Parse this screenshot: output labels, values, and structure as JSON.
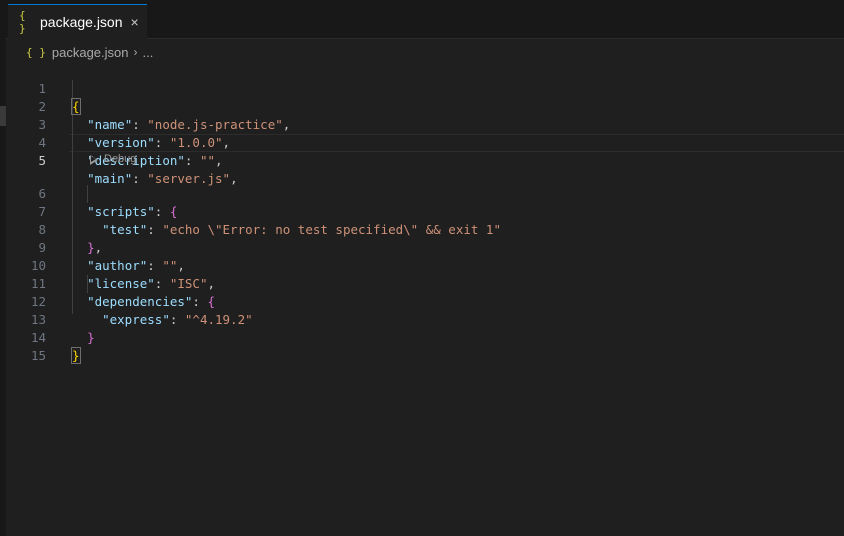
{
  "tab": {
    "icon": "{ }",
    "label": "package.json",
    "close": "×",
    "icon_name": "json-icon"
  },
  "breadcrumb": {
    "icon": "{ }",
    "file": "package.json",
    "separator": "›",
    "more": "..."
  },
  "codelens": {
    "label": "Debug",
    "icon_name": "play-icon"
  },
  "colors": {
    "key": "#9cdcfe",
    "string": "#ce9178",
    "bracket1": "#ffd700",
    "bracket2": "#da70d6",
    "accent": "#0078d4"
  },
  "editor": {
    "active_line": 5,
    "lines": [
      {
        "n": "1"
      },
      {
        "n": "2",
        "key": "\"name\"",
        "val": "\"node.js-practice\""
      },
      {
        "n": "3",
        "key": "\"version\"",
        "val": "\"1.0.0\""
      },
      {
        "n": "4",
        "key": "\"description\"",
        "val": "\"\""
      },
      {
        "n": "5",
        "key": "\"main\"",
        "val": "\"server.js\""
      },
      {
        "n": "6",
        "key": "\"scripts\""
      },
      {
        "n": "7",
        "key": "\"test\"",
        "val": "\"echo \\\"Error: no test specified\\\" && exit 1\""
      },
      {
        "n": "8"
      },
      {
        "n": "9",
        "key": "\"author\"",
        "val": "\"\""
      },
      {
        "n": "10",
        "key": "\"license\"",
        "val": "\"ISC\""
      },
      {
        "n": "11",
        "key": "\"dependencies\""
      },
      {
        "n": "12",
        "key": "\"express\"",
        "val": "\"^4.19.2\""
      },
      {
        "n": "13"
      },
      {
        "n": "14"
      },
      {
        "n": "15"
      }
    ]
  }
}
